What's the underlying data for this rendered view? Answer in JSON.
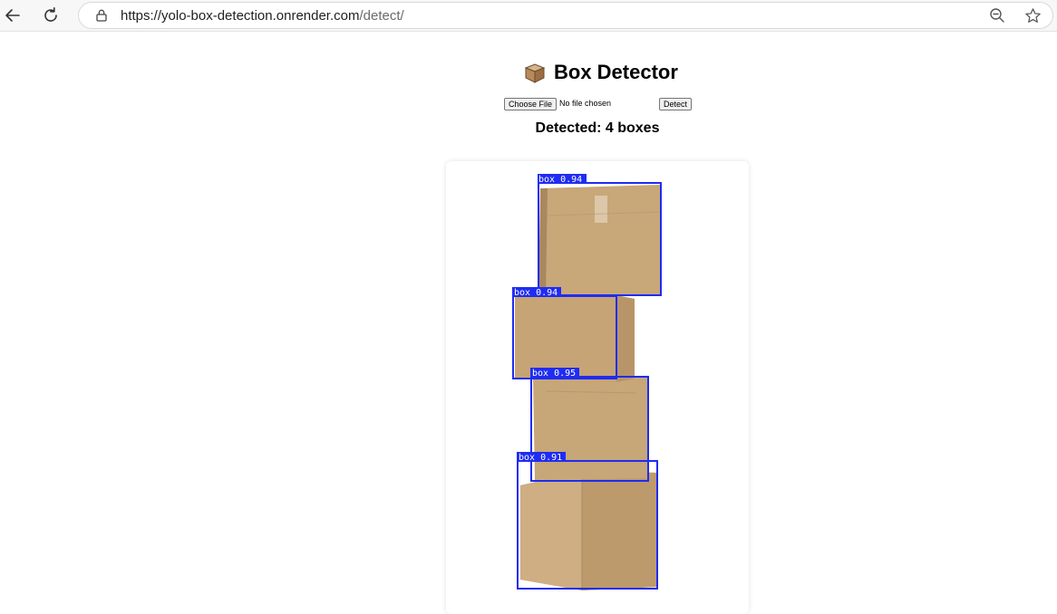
{
  "browser": {
    "url_host": "https://yolo-box-detection.onrender.com",
    "url_path": "/detect/"
  },
  "page": {
    "title": "Box Detector",
    "icon": "box-icon"
  },
  "upload": {
    "choose_file_label": "Choose File",
    "file_status": "No file chosen",
    "detect_label": "Detect"
  },
  "result": {
    "heading": "Detected: 4 boxes",
    "detections": [
      {
        "label": "box 0.94"
      },
      {
        "label": "box 0.94"
      },
      {
        "label": "box 0.95"
      },
      {
        "label": "box 0.91"
      }
    ]
  },
  "colors": {
    "bbox": "#1f2cf2",
    "cardboard": "#c9a77a"
  }
}
